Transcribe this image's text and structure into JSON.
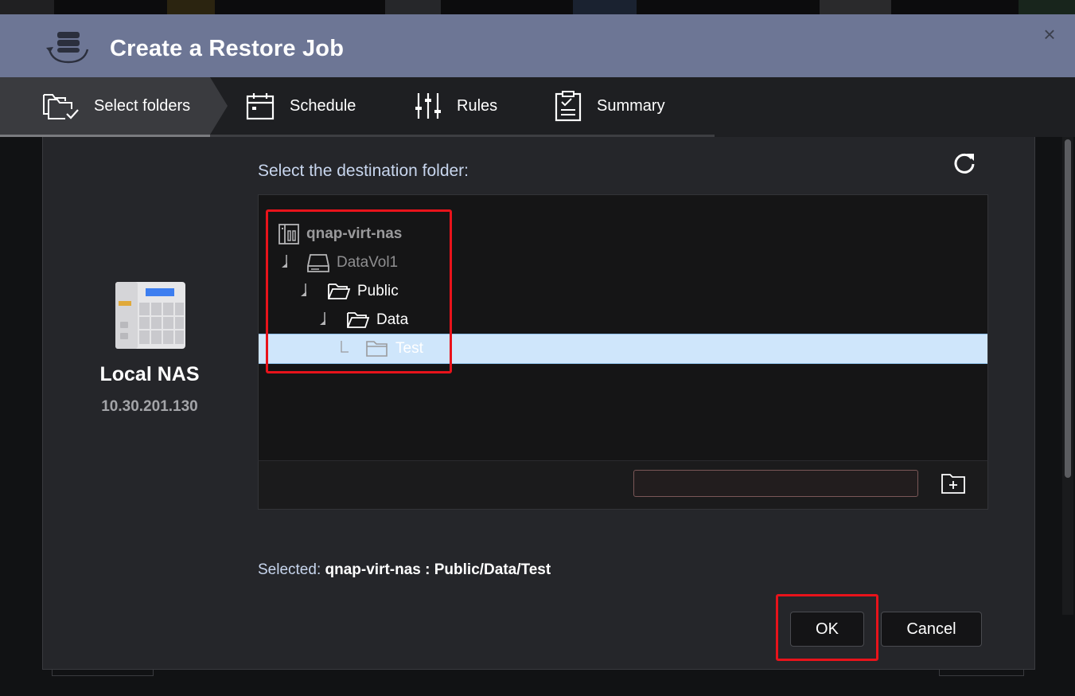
{
  "dialog": {
    "title": "Create a Restore Job",
    "close_label": "×"
  },
  "steps": [
    {
      "label": "Select folders",
      "icon": "folder-check-icon",
      "active": true
    },
    {
      "label": "Schedule",
      "icon": "calendar-icon",
      "active": false
    },
    {
      "label": "Rules",
      "icon": "sliders-icon",
      "active": false
    },
    {
      "label": "Summary",
      "icon": "clipboard-icon",
      "active": false
    }
  ],
  "source": {
    "name": "Local NAS",
    "ip": "10.30.201.130"
  },
  "destination": {
    "label": "Select the destination folder:",
    "tree": [
      {
        "label": "qnap-virt-nas",
        "icon": "nas-server-icon",
        "level": 0,
        "color": "#9a9a9c",
        "bold": true
      },
      {
        "label": "DataVol1",
        "icon": "drive-icon",
        "level": 1,
        "color": "#8e8e90",
        "bold": false
      },
      {
        "label": "Public",
        "icon": "folder-open-icon",
        "level": 2,
        "color": "#ffffff",
        "bold": false
      },
      {
        "label": "Data",
        "icon": "folder-open-icon",
        "level": 3,
        "color": "#ffffff",
        "bold": false
      },
      {
        "label": "Test",
        "icon": "folder-icon",
        "level": 4,
        "color": "#ffffff",
        "bold": false,
        "selected": true
      }
    ],
    "new_folder_value": "",
    "new_folder_placeholder": ""
  },
  "selected": {
    "key": "Selected:",
    "value": "qnap-virt-nas : Public/Data/Test"
  },
  "buttons": {
    "ok": "OK",
    "cancel": "Cancel"
  },
  "colors": {
    "titlebar": "#6d7695",
    "highlight": "#e8131b",
    "selected_row": "#cfe6fb",
    "label_blue": "#c8d6ee"
  }
}
